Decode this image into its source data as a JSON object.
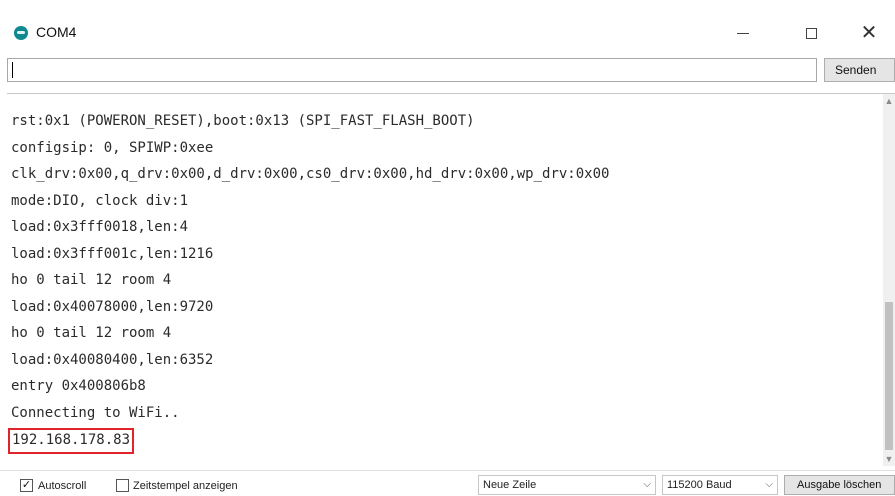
{
  "window": {
    "title": "COM4",
    "minimize_icon": "minimize-icon",
    "maximize_icon": "maximize-icon",
    "close_icon": "close-icon"
  },
  "input": {
    "value": "",
    "send_label": "Senden"
  },
  "log": {
    "lines": [
      "rst:0x1 (POWERON_RESET),boot:0x13 (SPI_FAST_FLASH_BOOT)",
      "configsip: 0, SPIWP:0xee",
      "clk_drv:0x00,q_drv:0x00,d_drv:0x00,cs0_drv:0x00,hd_drv:0x00,wp_drv:0x00",
      "mode:DIO, clock div:1",
      "load:0x3fff0018,len:4",
      "load:0x3fff001c,len:1216",
      "ho 0 tail 12 room 4",
      "load:0x40078000,len:9720",
      "ho 0 tail 12 room 4",
      "load:0x40080400,len:6352",
      "entry 0x400806b8",
      "Connecting to WiFi..",
      "192.168.178.83"
    ],
    "highlight_color": "#e0242b"
  },
  "status": {
    "autoscroll_label": "Autoscroll",
    "autoscroll_checked": true,
    "timestamp_label": "Zeitstempel anzeigen",
    "timestamp_checked": false,
    "line_ending": "Neue Zeile",
    "baud": "115200 Baud",
    "clear_label": "Ausgabe löschen"
  }
}
